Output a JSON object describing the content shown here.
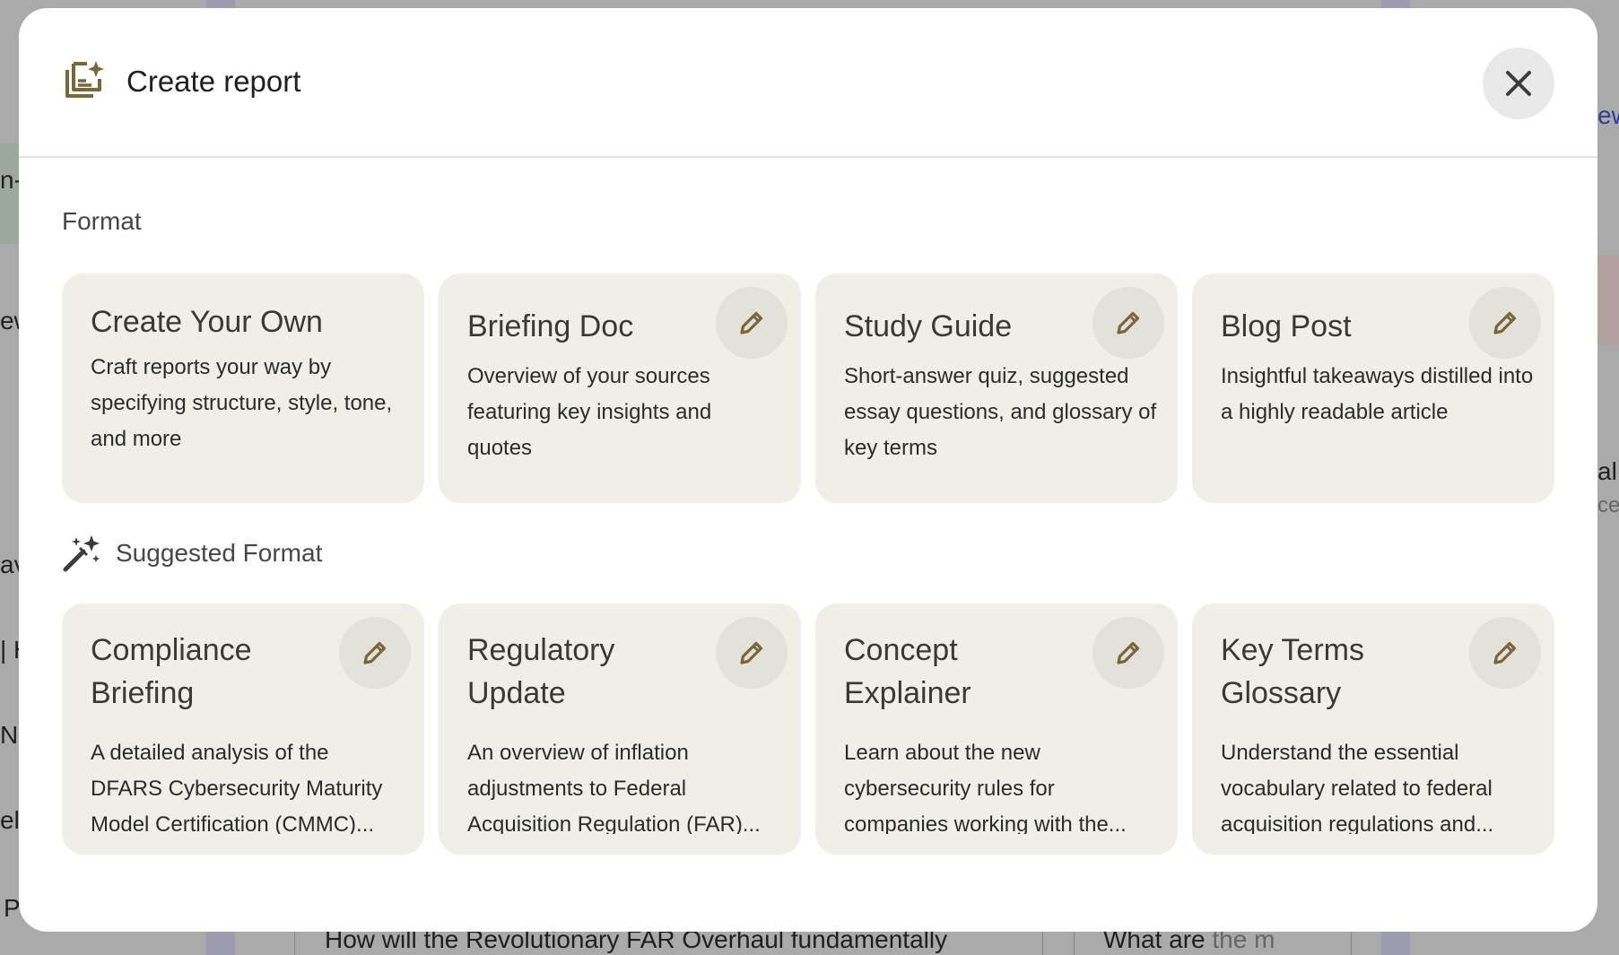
{
  "background": {
    "fragments": {
      "left1": "n-c",
      "left2": "ew",
      "left3": "av",
      "left4": "| H",
      "left5": "N",
      "left6": "el",
      "left7": "P",
      "right1": "ew",
      "right2": "al",
      "right3": "ce"
    },
    "bottom_question_1": "How will the Revolutionary FAR Overhaul fundamentally",
    "bottom_question_2_dark": "What are ",
    "bottom_question_2_faint": "the m"
  },
  "dialog": {
    "title": "Create report",
    "icon": "report-sparkle-icon",
    "close_icon": "close-icon"
  },
  "format_section": {
    "label": "Format",
    "cards": [
      {
        "title": "Create Your Own",
        "description": "Craft reports your way by specifying structure, style, tone, and more"
      },
      {
        "title": "Briefing Doc",
        "description": "Overview of your sources featuring key insights and quotes"
      },
      {
        "title": "Study Guide",
        "description": "Short-answer quiz, suggested essay questions, and glossary of key terms"
      },
      {
        "title": "Blog Post",
        "description": "Insightful takeaways distilled into a highly readable article"
      }
    ]
  },
  "suggested_section": {
    "label": "Suggested Format",
    "icon": "magic-wand-icon",
    "cards": [
      {
        "title": "Compliance Briefing",
        "description": "A detailed analysis of the DFARS Cybersecurity Maturity Model Certification (CMMC)..."
      },
      {
        "title": "Regulatory Update",
        "description": "An overview of inflation adjustments to Federal Acquisition Regulation (FAR)..."
      },
      {
        "title": "Concept Explainer",
        "description": "Learn about the new cybersecurity rules for companies working with the..."
      },
      {
        "title": "Key Terms Glossary",
        "description": "Understand the essential vocabulary related to federal acquisition regulations and..."
      }
    ]
  },
  "colors": {
    "accent": "#7a6636",
    "card_bg": "#f0efe7",
    "edit_button_bg": "#e2e1da"
  }
}
